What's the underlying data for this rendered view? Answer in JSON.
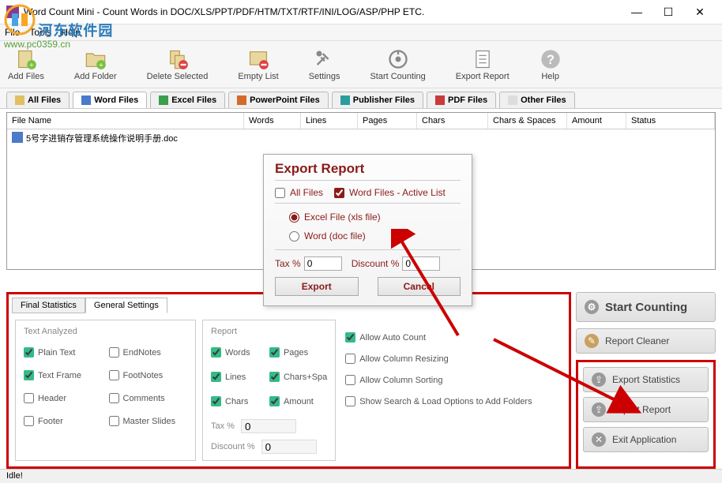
{
  "window": {
    "title": "Word Count Mini - Count Words in DOC/XLS/PPT/PDF/HTM/TXT/RTF/INI/LOG/ASP/PHP ETC."
  },
  "watermark": {
    "text": "河东软件园",
    "url": "www.pc0359.cn"
  },
  "menu": {
    "file": "File",
    "tools": "Tools",
    "help": "Help"
  },
  "toolbar": {
    "add_files": "Add Files",
    "add_folder": "Add Folder",
    "delete_selected": "Delete Selected",
    "empty_list": "Empty List",
    "settings": "Settings",
    "start_counting": "Start Counting",
    "export_report": "Export Report",
    "help": "Help"
  },
  "filetabs": {
    "all": "All Files",
    "word": "Word Files",
    "excel": "Excel Files",
    "ppt": "PowerPoint Files",
    "pub": "Publisher Files",
    "pdf": "PDF Files",
    "other": "Other Files"
  },
  "columns": {
    "name": "File Name",
    "words": "Words",
    "lines": "Lines",
    "pages": "Pages",
    "chars": "Chars",
    "chars_spaces": "Chars & Spaces",
    "amount": "Amount",
    "status": "Status"
  },
  "rows": [
    {
      "name": "5号字进销存管理系统操作说明手册.doc"
    }
  ],
  "settings_tabs": {
    "final": "Final Statistics",
    "general": "General Settings"
  },
  "text_analyzed": {
    "legend": "Text Analyzed",
    "plain": "Plain Text",
    "endnotes": "EndNotes",
    "frame": "Text Frame",
    "footnotes": "FootNotes",
    "header": "Header",
    "comments": "Comments",
    "footer": "Footer",
    "master": "Master Slides"
  },
  "report": {
    "legend": "Report",
    "words": "Words",
    "pages": "Pages",
    "lines": "Lines",
    "chars_sp": "Chars+Spa",
    "chars": "Chars",
    "amount": "Amount",
    "tax_label": "Tax %",
    "tax_val": "0",
    "disc_label": "Discount %",
    "disc_val": "0"
  },
  "options": {
    "auto": "Allow Auto Count",
    "resize": "Allow Column Resizing",
    "sort": "Allow Column Sorting",
    "search": "Show Search & Load Options to Add Folders"
  },
  "side": {
    "start": "Start Counting",
    "cleaner": "Report Cleaner",
    "export_stats": "Export Statistics",
    "export_report": "Export Report",
    "exit": "Exit Application"
  },
  "dialog": {
    "title": "Export Report",
    "all_files": "All Files",
    "word_files": "Word Files - Active List",
    "excel_opt": "Excel File (xls file)",
    "word_opt": "Word (doc file)",
    "tax_label": "Tax %",
    "tax_val": "0",
    "disc_label": "Discount %",
    "disc_val": "0",
    "export": "Export",
    "cancel": "Cancel"
  },
  "status": "Idle!"
}
